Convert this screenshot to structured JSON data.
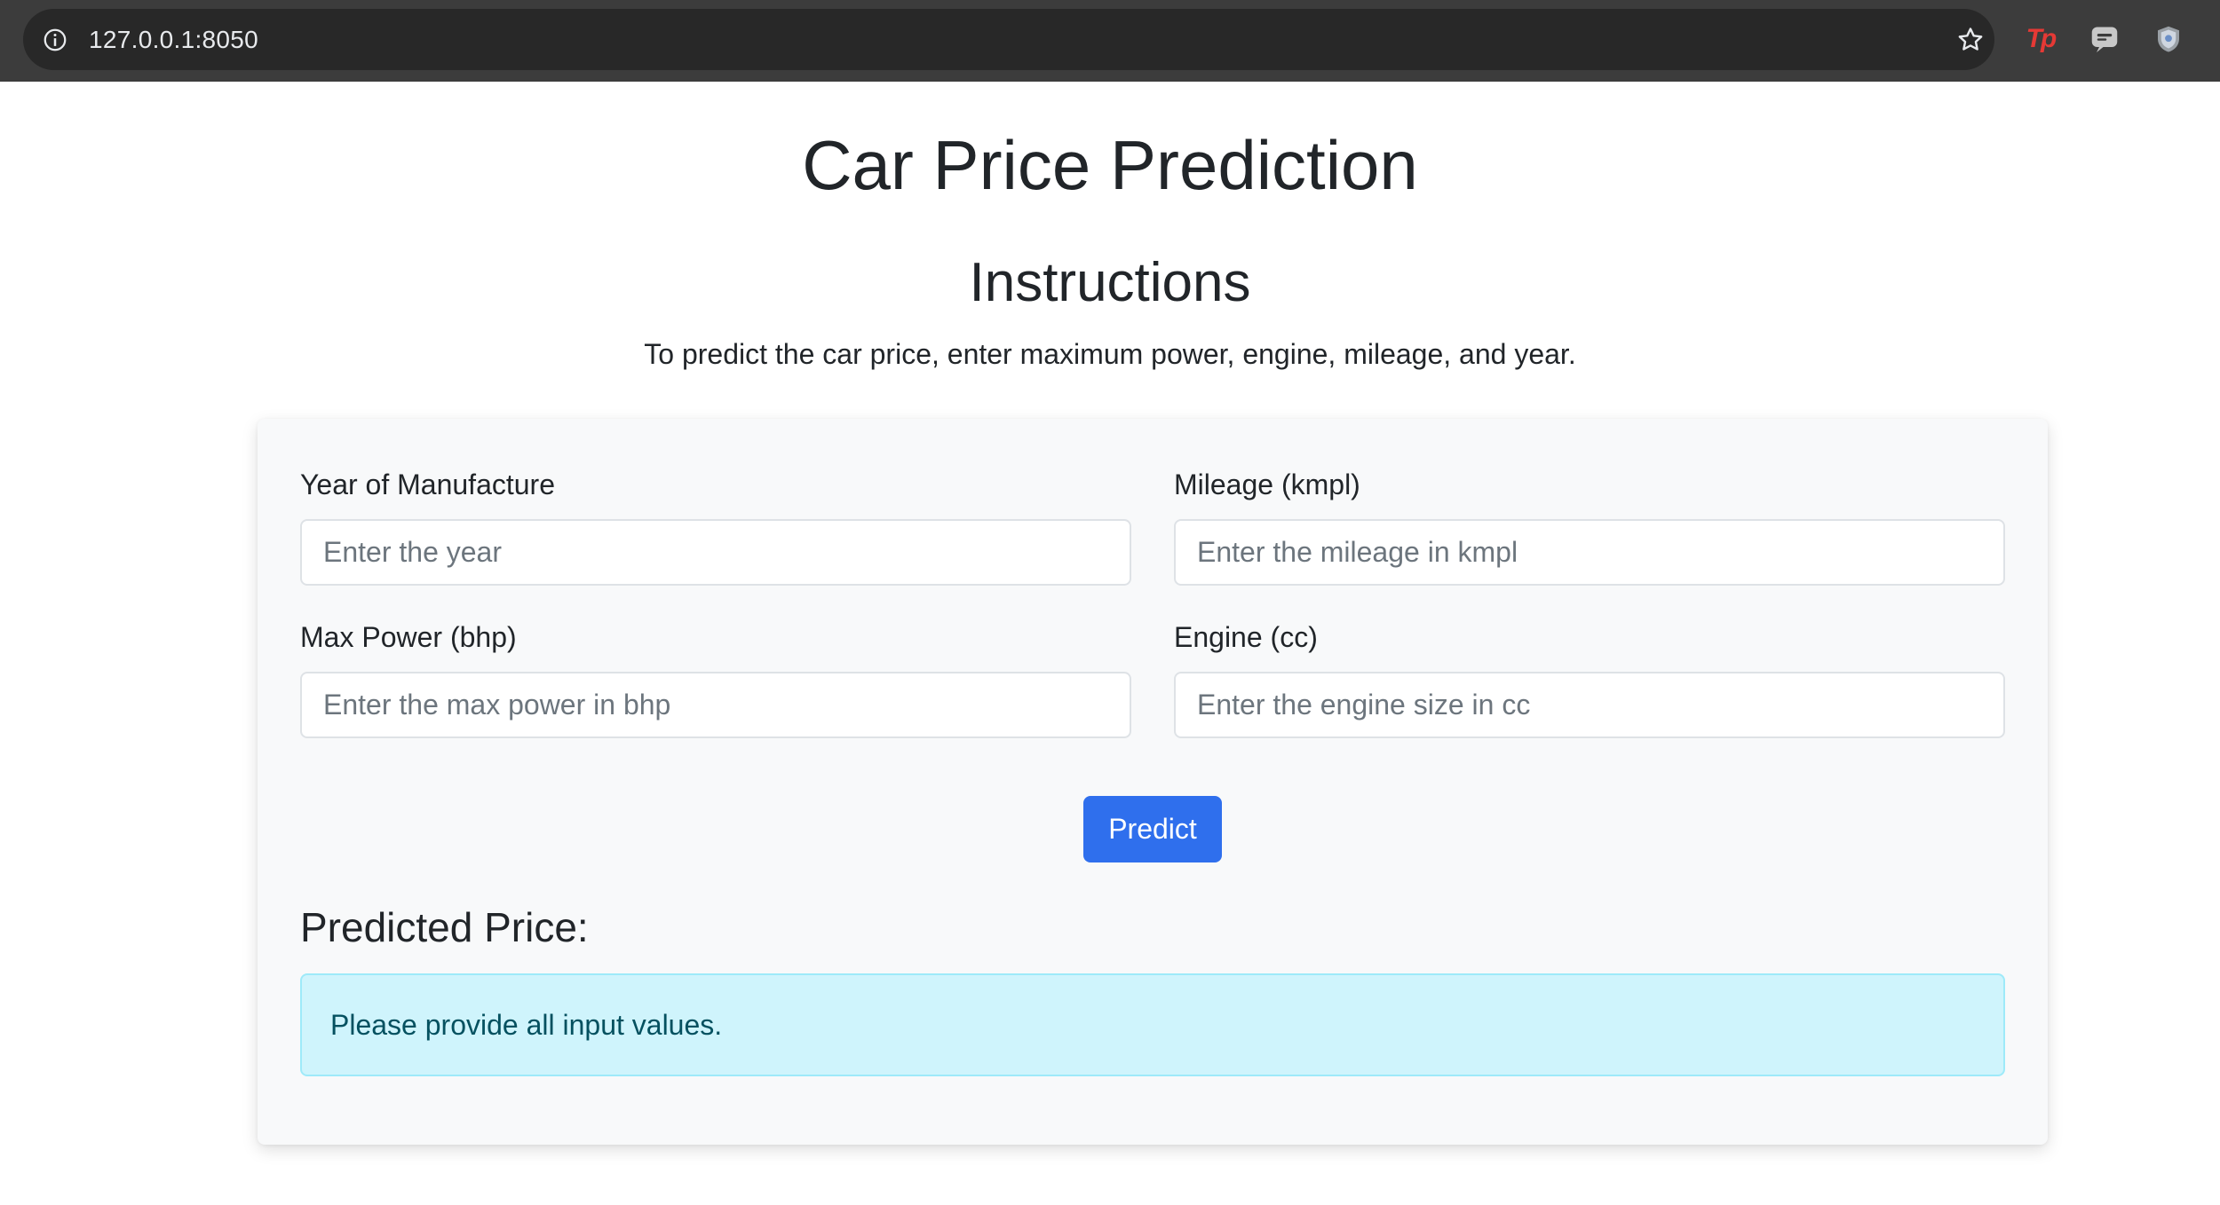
{
  "browser": {
    "url": "127.0.0.1:8050",
    "icons": [
      "info-icon",
      "star-icon",
      "tp-extension-icon",
      "chat-extension-icon",
      "shield-extension-icon"
    ],
    "tp_ext_label": "Tp"
  },
  "page": {
    "title": "Car Price Prediction",
    "subtitle": "Instructions",
    "instruction": "To predict the car price, enter maximum power, engine, mileage, and year."
  },
  "form": {
    "year": {
      "label": "Year of Manufacture",
      "placeholder": "Enter the year",
      "value": ""
    },
    "mileage": {
      "label": "Mileage (kmpl)",
      "placeholder": "Enter the mileage in kmpl",
      "value": ""
    },
    "max_power": {
      "label": "Max Power (bhp)",
      "placeholder": "Enter the max power in bhp",
      "value": ""
    },
    "engine": {
      "label": "Engine (cc)",
      "placeholder": "Enter the engine size in cc",
      "value": ""
    },
    "predict_label": "Predict"
  },
  "result": {
    "heading": "Predicted Price:",
    "message": "Please provide all input values."
  },
  "colors": {
    "primary": "#2f6fed",
    "alert_bg": "#cff4fc",
    "alert_border": "#9eeaf9",
    "alert_text": "#055160",
    "card_bg": "#f8f9fa"
  }
}
